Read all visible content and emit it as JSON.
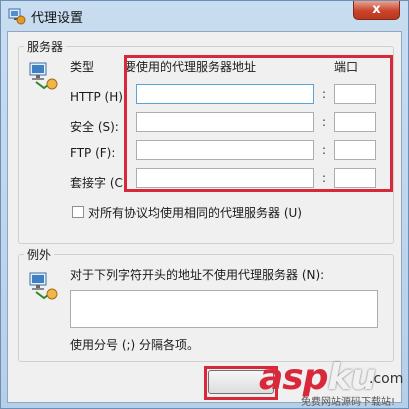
{
  "window": {
    "title": "代理设置",
    "close_glyph": "x"
  },
  "servers": {
    "group_label": "服务器",
    "type_header": "类型",
    "address_header": "要使用的代理服务器地址",
    "port_header": "端口",
    "rows": [
      {
        "type": "HTTP (H):",
        "address": "",
        "port": ""
      },
      {
        "type": "安全 (S):",
        "address": "",
        "port": ""
      },
      {
        "type": "FTP (F):",
        "address": "",
        "port": ""
      },
      {
        "type": "套接字 (C)",
        "address": "",
        "port": ""
      }
    ],
    "colon": ":",
    "same_proxy_label": "对所有协议均使用相同的代理服务器 (U)",
    "same_proxy_checked": false
  },
  "exceptions": {
    "group_label": "例外",
    "description": "对于下列字符开头的地址不使用代理服务器 (N):",
    "value": "",
    "hint": "使用分号 (;) 分隔各项。"
  },
  "watermark": {
    "brand_red": "asp",
    "brand_white": "ku",
    "brand_suffix": ".com",
    "tagline": "免费网站源码下载站!"
  },
  "colors": {
    "highlight_box": "#d8283a",
    "focus_border": "#5aa3d8"
  }
}
